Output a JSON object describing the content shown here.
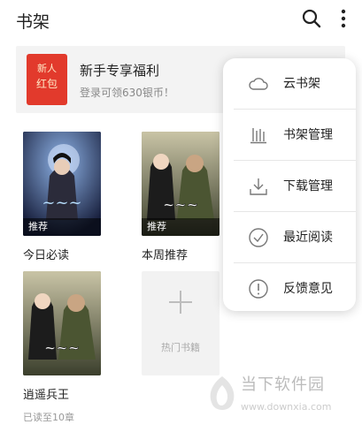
{
  "header": {
    "title": "书架",
    "search_icon": "search-icon",
    "more_icon": "more-vertical-icon"
  },
  "promo": {
    "badge_line1": "新人",
    "badge_line2": "红包",
    "title": "新手专享福利",
    "subtitle": "登录可领630银币！"
  },
  "books": [
    {
      "title": "今日必读",
      "tag": "推荐"
    },
    {
      "title": "本周推荐",
      "tag": "推荐"
    },
    {
      "title": "逍遥兵王",
      "status": "已读至10章"
    }
  ],
  "add_card": {
    "label": "热门书籍"
  },
  "menu": {
    "items": [
      {
        "label": "云书架",
        "icon": "cloud-icon"
      },
      {
        "label": "书架管理",
        "icon": "bookshelf-manage-icon"
      },
      {
        "label": "下载管理",
        "icon": "download-icon"
      },
      {
        "label": "最近阅读",
        "icon": "check-circle-icon"
      },
      {
        "label": "反馈意见",
        "icon": "exclamation-circle-icon"
      }
    ]
  },
  "watermark": {
    "name": "当下软件园",
    "url": "www.downxia.com"
  }
}
